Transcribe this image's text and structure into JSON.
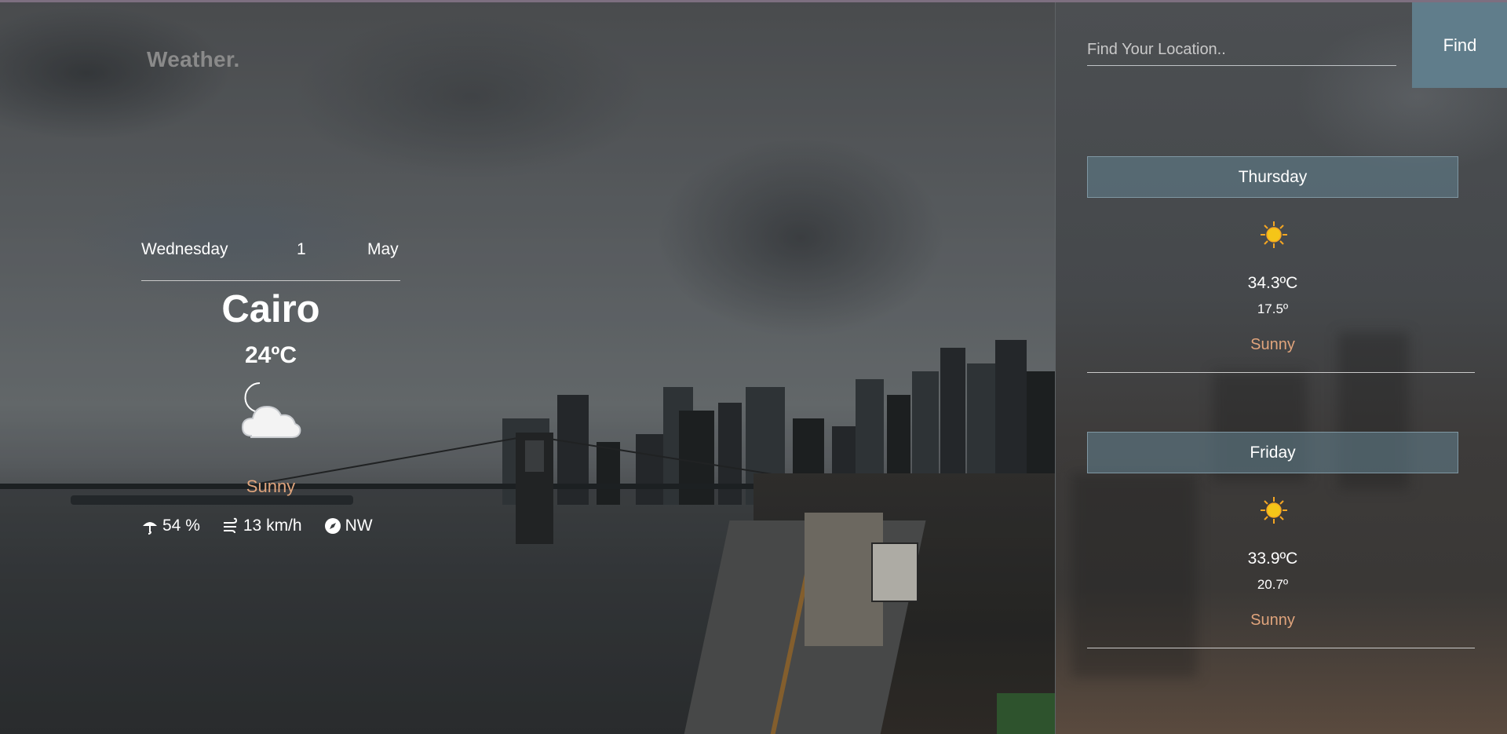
{
  "app": {
    "brand": "Weather."
  },
  "current": {
    "day": "Wednesday",
    "date_number": "1",
    "month": "May",
    "city": "Cairo",
    "temperature": "24ºC",
    "condition": "Sunny",
    "condition_icon": "night-cloud-icon",
    "humidity": "54 %",
    "wind_speed": "13 km/h",
    "wind_direction": "NW"
  },
  "search": {
    "placeholder": "Find Your Location..",
    "value": "",
    "button_label": "Find"
  },
  "forecast": [
    {
      "day": "Thursday",
      "icon": "sun-icon",
      "max": "34.3ºC",
      "min": "17.5º",
      "condition": "Sunny"
    },
    {
      "day": "Friday",
      "icon": "sun-icon",
      "max": "33.9ºC",
      "min": "20.7º",
      "condition": "Sunny"
    }
  ],
  "colors": {
    "accent": "#607d8b",
    "condition_text": "#e0a47c",
    "sun": "#f5c518"
  }
}
